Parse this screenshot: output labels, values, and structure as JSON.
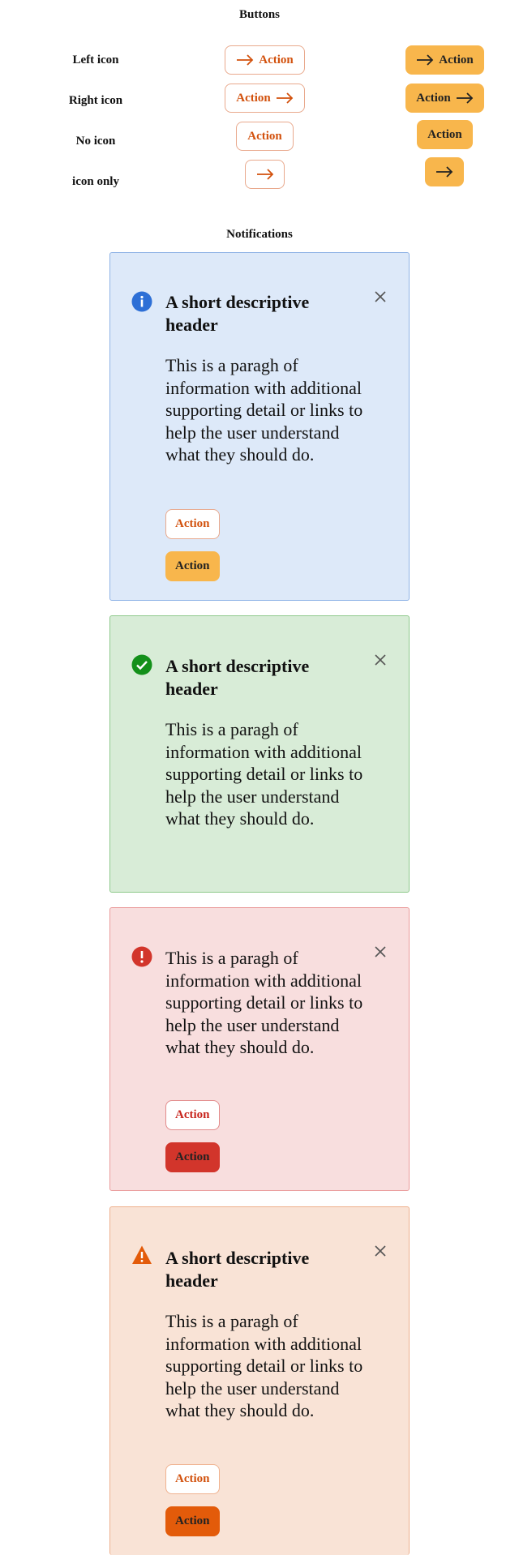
{
  "buttons_section": {
    "title": "Buttons",
    "rows": [
      {
        "label": "Left icon",
        "action": "Action"
      },
      {
        "label": "Right icon",
        "action": "Action"
      },
      {
        "label": "No icon",
        "action": "Action"
      },
      {
        "label": "icon only",
        "action": ""
      }
    ],
    "icon": "arrow-right-icon"
  },
  "notifications_section": {
    "title": "Notifications",
    "cards": [
      {
        "type": "info",
        "icon": "info-icon",
        "title": "A short descriptive header",
        "body": "This is a paragh of information with additional supporting detail or links to help the user understand what they should do.",
        "secondary_action": "Action",
        "primary_action": "Action"
      },
      {
        "type": "success",
        "icon": "check-circle-icon",
        "title": "A short descriptive header",
        "body": "This is a paragh of information with additional supporting detail or links to help the user understand what they should do."
      },
      {
        "type": "error",
        "icon": "error-icon",
        "body": "This is a paragh of information with additional supporting detail or links to help the user understand what they should do.",
        "secondary_action": "Action",
        "primary_action": "Action"
      },
      {
        "type": "warning",
        "icon": "warning-icon",
        "title": "A short descriptive header",
        "body": "This is a paragh of information with additional supporting detail or links to help the user understand what they should do.",
        "secondary_action": "Action",
        "primary_action": "Action"
      }
    ]
  },
  "colors": {
    "accent_orange": "#d2510d",
    "fill_orange": "#f8b64c",
    "info_bg": "#dde9f9",
    "success_bg": "#d8ecd7",
    "error_bg": "#f8dede",
    "warning_bg": "#f9e3d6"
  }
}
